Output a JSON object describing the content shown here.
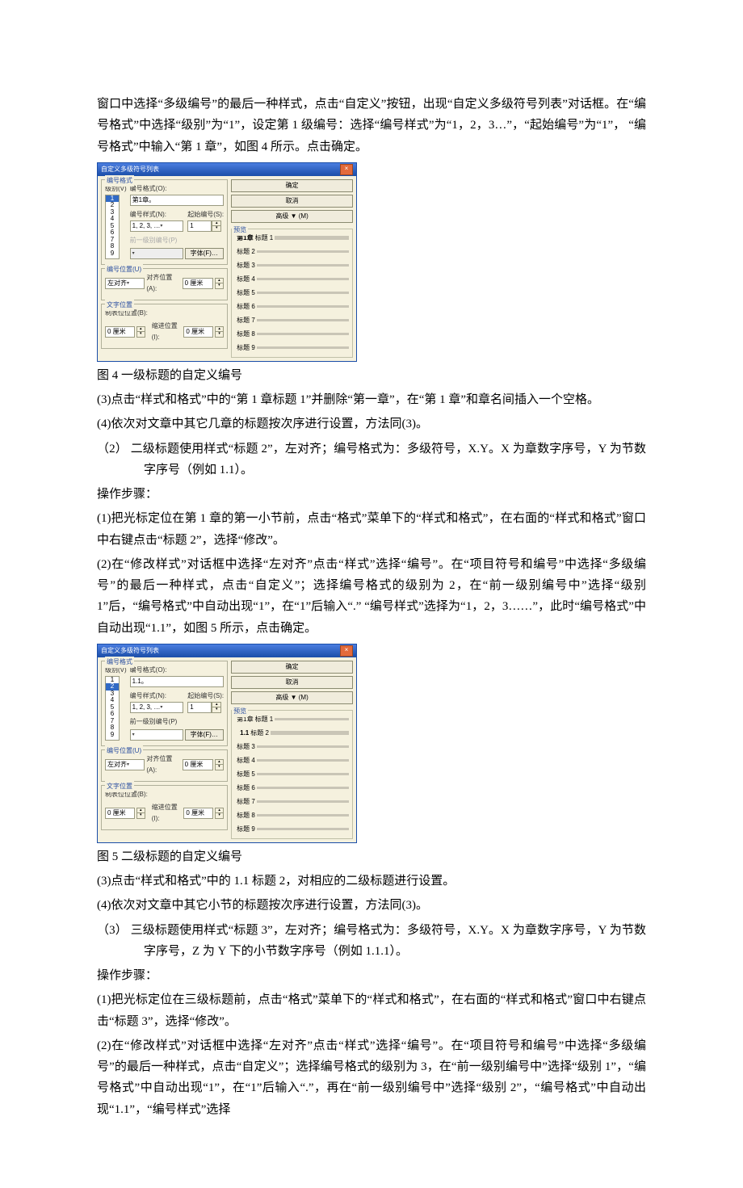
{
  "a": {
    "p0": "窗口中选择“多级编号”的最后一种样式，点击“自定义”按钮，出现“自定义多级符号列表”对话框。在“编号格式”中选择“级别”为“1”，设定第 1 级编号：选择“编号样式”为“1，2，3…”，“起始编号”为“1”，   “编号格式”中输入“第 1 章”，如图 4 所示。点击确定。",
    "cap4": "图 4 一级标题的自定义编号",
    "p3": "(3)点击“样式和格式”中的“第 1 章标题 1”并删除“第一章”，在“第 1 章”和章名间插入一个空格。",
    "p4": "(4)依次对文章中其它几章的标题按次序进行设置，方法同(3)。",
    "it2": "（2）   二级标题使用样式“标题 2”，左对齐；编号格式为：多级符号，X.Y。X 为章数字序号，Y 为节数字序号（例如 1.1）。",
    "steps_a": "操作步骤：",
    "p5": "(1)把光标定位在第 1 章的第一小节前，点击“格式”菜单下的“样式和格式”，在右面的“样式和格式”窗口中右键点击“标题 2”，选择“修改”。",
    "p6": "(2)在“修改样式”对话框中选择“左对齐”点击“样式”选择“编号”。在“项目符号和编号”中选择“多级编号”的最后一种样式，点击“自定义”；选择编号格式的级别为 2，在“前一级别编号中”选择“级别 1”后，“编号格式”中自动出现“1”，在“1”后输入“.” “编号样式”选择为“1，2，3……”，此时“编号格式”中自动出现“1.1”，如图 5 所示，点击确定。",
    "cap5": "图 5 二级标题的自定义编号",
    "p8": "(3)点击“样式和格式”中的 1.1 标题 2，对相应的二级标题进行设置。",
    "p9": "(4)依次对文章中其它小节的标题按次序进行设置，方法同(3)。",
    "it3": "（3）   三级标题使用样式“标题 3”，左对齐；编号格式为：多级符号，X.Y。X 为章数字序号，Y 为节数字序号，Z 为 Y 下的小节数字序号（例如 1.1.1）。",
    "steps_b": "操作步骤：",
    "p10": "(1)把光标定位在三级标题前，点击“格式”菜单下的“样式和格式”，在右面的“样式和格式”窗口中右键点击“标题 3”，选择“修改”。",
    "p11": "(2)在“修改样式”对话框中选择“左对齐”点击“样式”选择“编号”。在“项目符号和编号”中选择“多级编号”的最后一种样式，点击“自定义”；选择编号格式的级别为 3，在“前一级别编号中”选择“级别 1”，“编号格式”中自动出现“1”，在“1”后输入“.”，再在“前一级别编号中”选择“级别 2”，“编号格式”中自动出现“1.1”，“编号样式”选择"
  },
  "dlg": {
    "title": "自定义多级符号列表",
    "close": "×",
    "grp_format": "编号格式",
    "lbl_level": "级别(V)",
    "lbl_numfmt": "编号格式(O):",
    "lbl_numstyle": "编号样式(N):",
    "lbl_startat": "起始编号(S):",
    "lbl_prevlevel": "前一级别编号(P)",
    "lbl_font": "字体(F)…",
    "grp_numpos": "编号位置(U)",
    "lbl_leftalign": "左对齐",
    "lbl_alignpos": "对齐位置(A):",
    "lbl_unit": "0 厘米",
    "grp_textpos": "文字位置",
    "lbl_tabstop": "制表位位置(B):",
    "lbl_indent": "缩进位置(I):",
    "btn_ok": "确定",
    "btn_cancel": "取消",
    "btn_advanced": "高级 ▼ (M)",
    "lbl_preview": "预览",
    "pv_chap": "第1章",
    "pv_head": "标题 1",
    "pv_h2": "标题 2",
    "pv_h3": "标题 3",
    "pv_h4": "标题 4",
    "pv_h5": "标题 5",
    "pv_h6": "标题 6",
    "pv_h7": "标题 7",
    "pv_h8": "标题 8",
    "pv_h9": "标题 9",
    "a": {
      "numfmt_val": "第1章。",
      "numstyle_val": "1, 2, 3, …",
      "start_val": "1",
      "sel_level": "1",
      "prevlevel_enabled": false
    },
    "b": {
      "numfmt_val": "1.1。",
      "numstyle_val": "1, 2, 3, …",
      "start_val": "1",
      "sel_level": "2",
      "pv_11": "1.1",
      "prevlevel_enabled": true
    }
  }
}
